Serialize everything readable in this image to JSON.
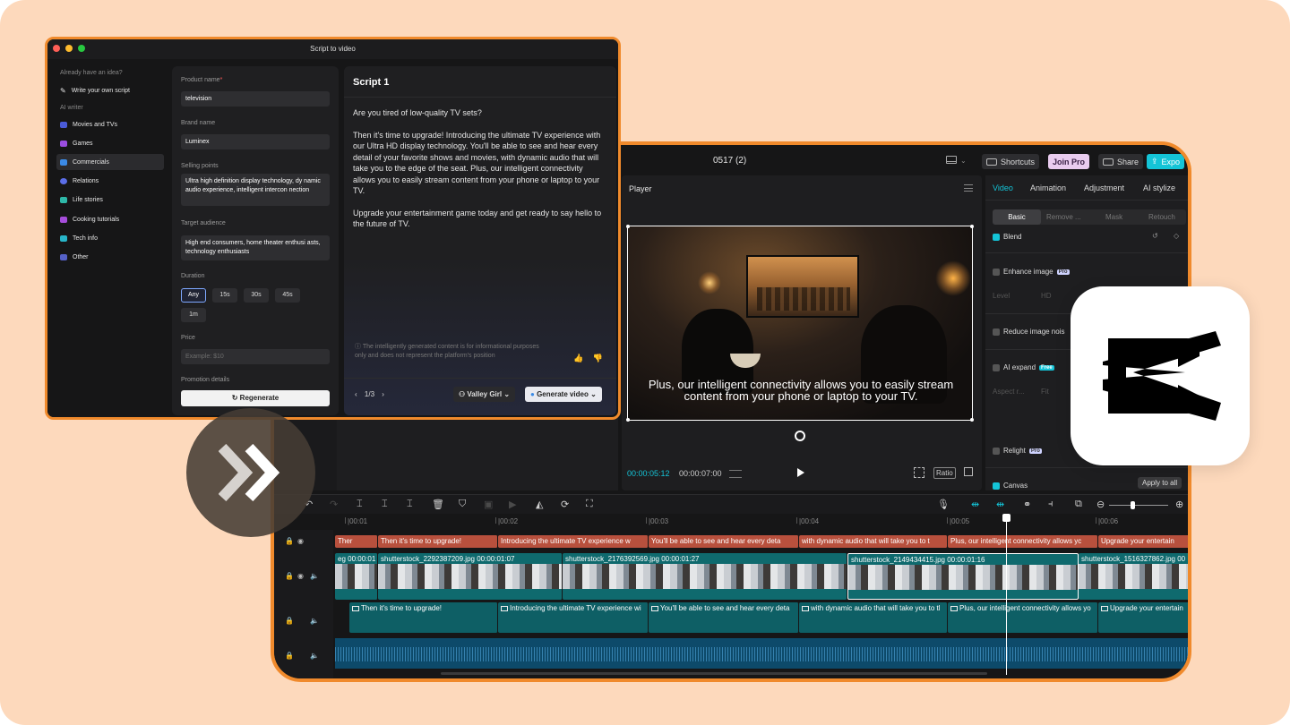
{
  "colors": {
    "background": "#fdd9bc",
    "accent": "#f08a2c",
    "teal": "#14c4d7"
  },
  "editor": {
    "project_title": "0517 (2)",
    "top_buttons": {
      "shortcuts": "Shortcuts",
      "join_pro": "Join Pro",
      "share": "Share",
      "export": "Expo"
    },
    "player": {
      "label": "Player",
      "subtitle": "Plus, our intelligent connectivity allows you to easily stream content from your phone or laptop to your TV.",
      "time_current": "00:00:05:12",
      "time_total": "00:00:07:00",
      "ratio": "Ratio"
    },
    "props": {
      "tabs": [
        "Video",
        "Animation",
        "Adjustment",
        "AI stylize"
      ],
      "subtabs": [
        "Basic",
        "Remove ...",
        "Mask",
        "Retouch"
      ],
      "blend": "Blend",
      "enhance": "Enhance image",
      "enhance_badge": "Pro",
      "level": "Level",
      "hd": "HD",
      "reduce_noise": "Reduce image nois",
      "ai_expand": "AI expand",
      "ai_expand_badge": "Free",
      "aspect": "Aspect r...",
      "fit": "Fit",
      "relight": "Relight",
      "relight_badge": "Pro",
      "canvas": "Canvas",
      "apply_all": "Apply to all"
    },
    "timeline": {
      "ticks": [
        "|00:01",
        "|00:02",
        "|00:03",
        "|00:04",
        "|00:05",
        "|00:06"
      ],
      "text_clips": [
        "Ther",
        "Then it's time to upgrade!",
        "Introducing the ultimate TV experience w",
        "You'll be able to see and hear every deta",
        "with dynamic audio that will take you to t",
        "Plus, our intelligent connectivity allows yc",
        "Upgrade your entertain"
      ],
      "video_clips": [
        {
          "name": "eg",
          "duration": "00:00:01"
        },
        {
          "name": "shutterstock_2292387209.jpg",
          "duration": "00:00:01:07"
        },
        {
          "name": "shutterstock_2176392569.jpg",
          "duration": "00:00:01:27"
        },
        {
          "name": "shutterstock_2149434415.jpg",
          "duration": "00:00:01:16"
        },
        {
          "name": "shutterstock_1516327862.jpg",
          "duration": "00"
        }
      ],
      "sub_clips": [
        "Then it's time to upgrade!",
        "Introducing the ultimate TV experience wi",
        "You'll be able to see and hear every deta",
        "with dynamic audio that will take you to tl",
        "Plus, our intelligent connectivity allows yo",
        "Upgrade your entertain"
      ]
    }
  },
  "script_window": {
    "title": "Script to video",
    "sidebar": {
      "idea_label": "Already have an idea?",
      "write_own": "Write your own script",
      "ai_writer_label": "AI writer",
      "items": [
        "Movies and TVs",
        "Games",
        "Commercials",
        "Relations",
        "Life stories",
        "Cooking tutorials",
        "Tech info",
        "Other"
      ]
    },
    "form": {
      "product_label": "Product name",
      "product_value": "television",
      "brand_label": "Brand name",
      "brand_value": "Luminex",
      "selling_label": "Selling points",
      "selling_value": "Ultra high definition display technology, dy namic audio experience, intelligent intercon nection",
      "audience_label": "Target audience",
      "audience_value": "High end consumers, home theater enthusi asts, technology enthusiasts",
      "duration_label": "Duration",
      "durations": [
        "Any",
        "15s",
        "30s",
        "45s",
        "1m"
      ],
      "price_label": "Price",
      "price_placeholder": "Example: $10",
      "promo_label": "Promotion details",
      "regenerate": "Regenerate"
    },
    "script": {
      "title": "Script 1",
      "paragraphs": [
        "Are you tired of low-quality TV sets?",
        "Then it's time to upgrade! Introducing the ultimate TV experience with our Ultra HD display technology. You'll be able to see and hear every detail of your favorite shows and movies, with dynamic audio that will take you to the edge of the seat. Plus, our intelligent connectivity allows you to easily stream content from your phone or laptop to your TV.",
        "Upgrade your entertainment game today and get ready to say hello to the future of TV."
      ],
      "disclaimer": "The intelligently generated content is for informational purposes only and does not represent the platform's position",
      "pager": "1/3",
      "voice": "Valley Girl",
      "generate": "Generate video"
    }
  }
}
